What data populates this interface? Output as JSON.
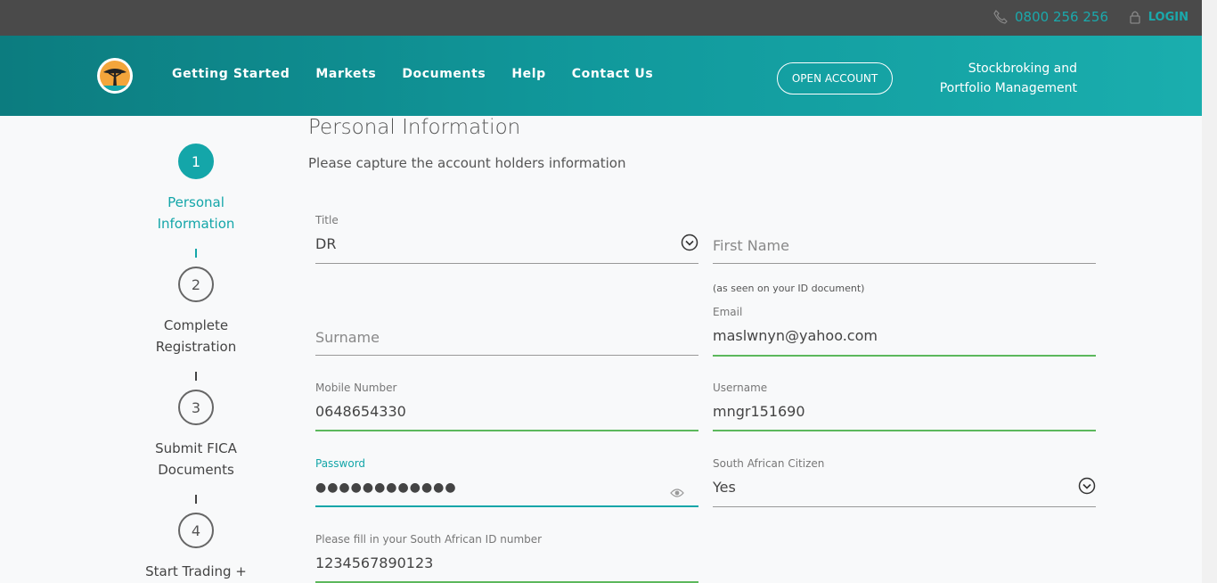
{
  "topbar": {
    "phone": "0800 256 256",
    "login": "LOGIN"
  },
  "header": {
    "nav": [
      "Getting Started",
      "Markets",
      "Documents",
      "Help",
      "Contact Us"
    ],
    "open_account": "OPEN ACCOUNT",
    "brand_line1": "Stockbroking and",
    "brand_line2": "Portfolio Management"
  },
  "steps": [
    {
      "number": "1",
      "line1": "Personal",
      "line2": "Information",
      "active": true
    },
    {
      "number": "2",
      "line1": "Complete",
      "line2": "Registration",
      "active": false
    },
    {
      "number": "3",
      "line1": "Submit FICA",
      "line2": "Documents",
      "active": false
    },
    {
      "number": "4",
      "line1": "Start Trading +",
      "line2": "",
      "active": false
    }
  ],
  "form": {
    "heading": "Personal Information",
    "subheading": "Please capture the account holders information",
    "title": {
      "label": "Title",
      "value": "DR"
    },
    "first_name": {
      "placeholder": "First Name"
    },
    "surname": {
      "placeholder": "Surname"
    },
    "email": {
      "note": "(as seen on your ID document)",
      "label": "Email",
      "value": "maslwnyn@yahoo.com"
    },
    "mobile": {
      "label": "Mobile Number",
      "value": "0648654330"
    },
    "username": {
      "label": "Username",
      "value": "mngr151690"
    },
    "password": {
      "label": "Password",
      "value": "●●●●●●●●●●●●"
    },
    "citizen": {
      "label": "South African Citizen",
      "value": "Yes"
    },
    "id_number": {
      "label": "Please fill in your South African ID number",
      "value": "1234567890123"
    }
  },
  "colors": {
    "teal": "#14a6a9",
    "valid_green": "#5cb85c",
    "topbar": "#4a4a4a"
  }
}
